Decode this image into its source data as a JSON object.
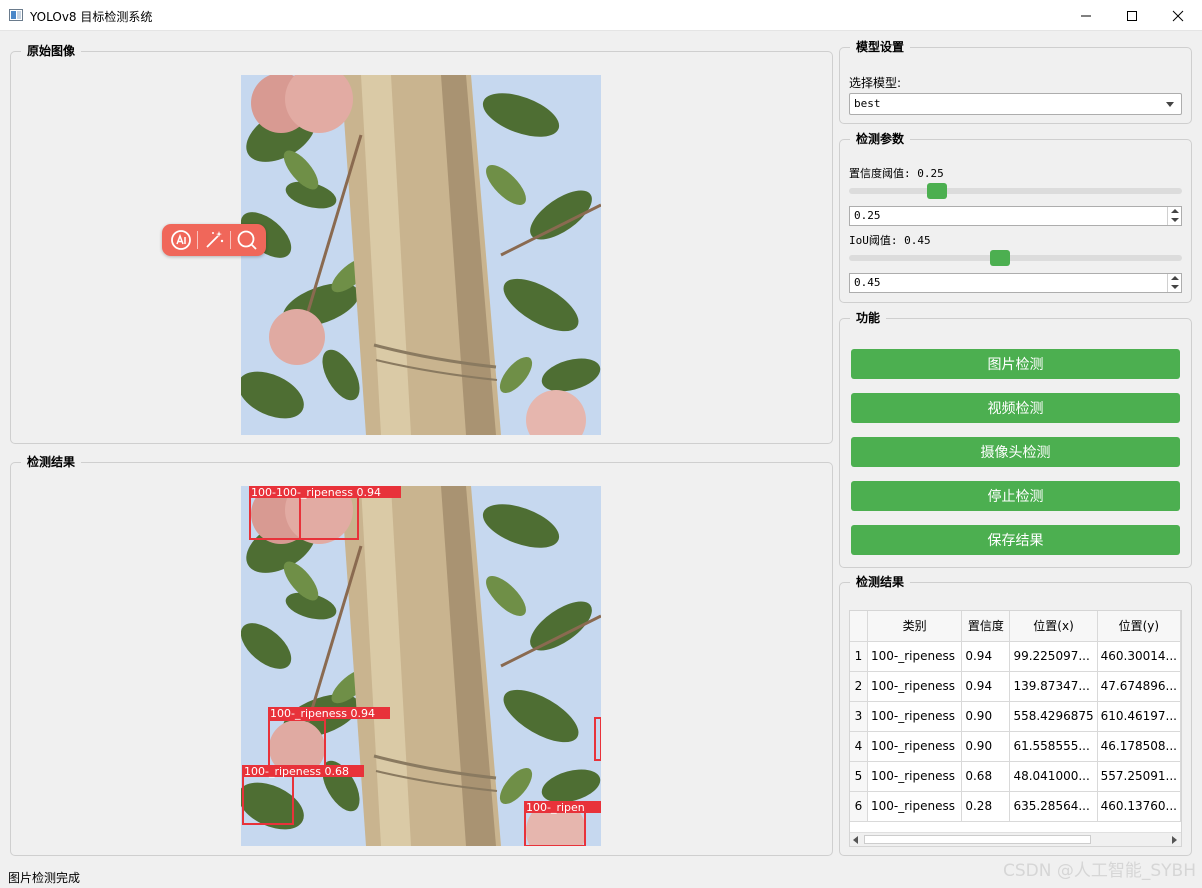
{
  "window": {
    "title": "YOLOv8 目标检测系统"
  },
  "original_panel": {
    "title": "原始图像"
  },
  "result_panel": {
    "title": "检测结果",
    "detection_labels": [
      "100-100-_ripeness 0.94",
      "100-_ripeness 0.94",
      "100-_ripeness 0.68",
      "100-_ripen"
    ]
  },
  "ai_toolbar": {
    "icons": [
      "ai-circle-icon",
      "magic-wand-icon",
      "search-icon"
    ]
  },
  "model_settings": {
    "title": "模型设置",
    "model_label": "选择模型:",
    "model_value": "best"
  },
  "detect_params": {
    "title": "检测参数",
    "conf_label": "置信度阈值: 0.25",
    "conf_value": "0.25",
    "conf_level": 0.25,
    "iou_label": "IoU阈值: 0.45",
    "iou_value": "0.45",
    "iou_level": 0.45
  },
  "functions": {
    "title": "功能",
    "buttons": [
      "图片检测",
      "视频检测",
      "摄像头检测",
      "停止检测",
      "保存结果"
    ]
  },
  "results_table": {
    "title": "检测结果",
    "headers": [
      "类别",
      "置信度",
      "位置(x)",
      "位置(y)"
    ],
    "rows": [
      {
        "num": "1",
        "cls": "100-_ripeness",
        "conf": "0.94",
        "x": "99.225097...",
        "y": "460.30014..."
      },
      {
        "num": "2",
        "cls": "100-_ripeness",
        "conf": "0.94",
        "x": "139.87347...",
        "y": "47.674896..."
      },
      {
        "num": "3",
        "cls": "100-_ripeness",
        "conf": "0.90",
        "x": "558.4296875",
        "y": "610.46197..."
      },
      {
        "num": "4",
        "cls": "100-_ripeness",
        "conf": "0.90",
        "x": "61.558555...",
        "y": "46.178508..."
      },
      {
        "num": "5",
        "cls": "100-_ripeness",
        "conf": "0.68",
        "x": "48.041000...",
        "y": "557.25091..."
      },
      {
        "num": "6",
        "cls": "100-_ripeness",
        "conf": "0.28",
        "x": "635.28564...",
        "y": "460.13760..."
      }
    ]
  },
  "status_bar": {
    "text": "图片检测完成"
  },
  "watermark": {
    "text": "CSDN @人工智能_SYBH"
  },
  "colors": {
    "accent_green": "#4caf50",
    "detection_red": "#e8323a",
    "toolbar_red": "#f0675a"
  }
}
